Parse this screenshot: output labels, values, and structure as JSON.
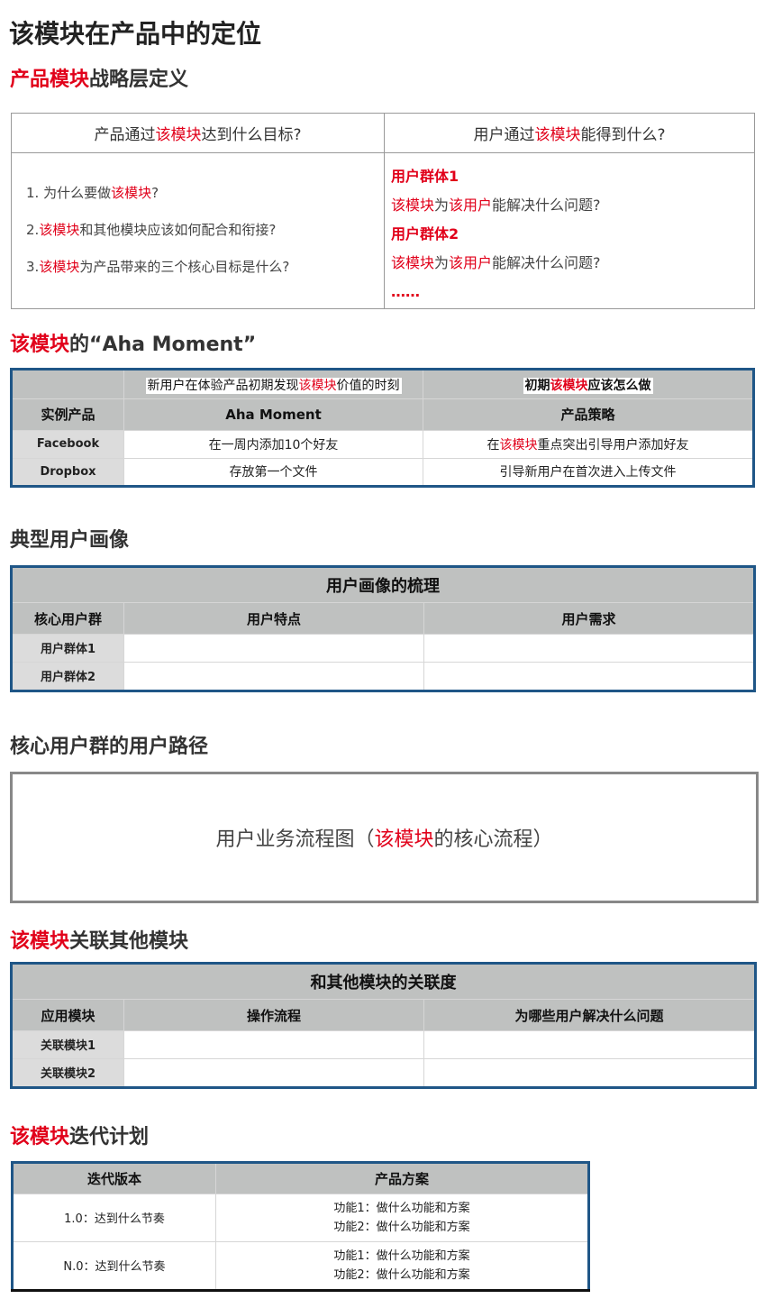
{
  "title": "该模块在产品中的定位",
  "s1": {
    "title_red": "产品模块",
    "title_rest": "战略层定义",
    "col1": [
      "产品通过",
      "该模块",
      "达到什么目标?"
    ],
    "col2": [
      "用户通过",
      "该模块",
      "能得到什么?"
    ],
    "q1": [
      "1. 为什么要做",
      "该模块",
      "?"
    ],
    "q2": [
      "2.",
      "该模块",
      "和其他模块应该如何配合和衔接?"
    ],
    "q3": [
      "3.",
      "该模块",
      "为产品带来的三个核心目标是什么?"
    ],
    "g1": "用户群体1",
    "g1q": [
      "该模块",
      "为",
      "该用户",
      "能解决什么问题?"
    ],
    "g2": "用户群体2",
    "g2q": [
      "该模块",
      "为",
      "该用户",
      "能解决什么问题?"
    ],
    "more": "……"
  },
  "s2": {
    "title_red": "该模块",
    "title_rest": "的“Aha Moment”",
    "top1": [
      "新用户在体验产品初期发现",
      "该模块",
      "价值的时刻"
    ],
    "top2": [
      "初期",
      "该模块",
      "应该怎么做"
    ],
    "headers": [
      "实例产品",
      "Aha Moment",
      "产品策略"
    ],
    "rows": [
      {
        "p": "Facebook",
        "a": "在一周内添加10个好友",
        "s": [
          "在",
          "该模块",
          "重点突出引导用户添加好友"
        ]
      },
      {
        "p": "Dropbox",
        "a": "存放第一个文件",
        "s": [
          "引导新用户在首次进入上传文件",
          "",
          ""
        ]
      }
    ]
  },
  "s3": {
    "title": "典型用户画像",
    "table_title": "用户画像的梳理",
    "headers": [
      "核心用户群",
      "用户特点",
      "用户需求"
    ],
    "rows": [
      "用户群体1",
      "用户群体2"
    ]
  },
  "s4": {
    "title": "核心用户群的用户路径",
    "box": [
      "用户业务流程图（",
      "该模块",
      "的核心流程）"
    ]
  },
  "s5": {
    "title_red": "该模块",
    "title_rest": "关联其他模块",
    "table_title": "和其他模块的关联度",
    "headers": [
      "应用模块",
      "操作流程",
      "为哪些用户解决什么问题"
    ],
    "rows": [
      "关联模块1",
      "关联模块2"
    ]
  },
  "s6": {
    "title_red": "该模块",
    "title_rest": "迭代计划",
    "headers": [
      "迭代版本",
      "产品方案"
    ],
    "rows": [
      {
        "v": "1.0：达到什么节奏",
        "f": [
          "功能1：做什么功能和方案",
          "功能2：做什么功能和方案"
        ]
      },
      {
        "v": "N.0：达到什么节奏",
        "f": [
          "功能1：做什么功能和方案",
          "功能2：做什么功能和方案"
        ]
      }
    ]
  },
  "colors": {
    "accent_red": "#e1001a",
    "table_border_blue": "#1f5687",
    "header_gray": "#bfc1c0"
  }
}
